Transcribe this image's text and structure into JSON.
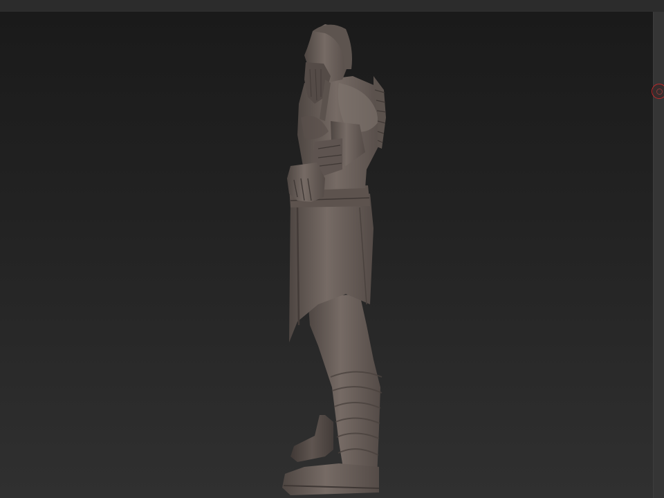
{
  "colors": {
    "viewport_top": "#1a1a1a",
    "viewport_bottom": "#303030",
    "ui_bg": "#2c2c2c",
    "gizmo_accent": "#c0282a",
    "model_clay": "#6b605b"
  },
  "icons": {
    "navigation": "orbit-gizmo-icon"
  }
}
